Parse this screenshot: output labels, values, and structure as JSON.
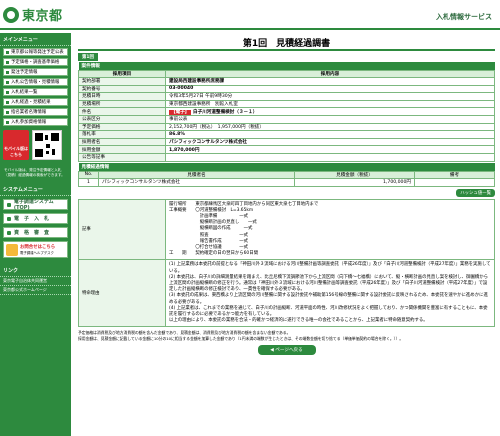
{
  "header": {
    "logo_text": "東京都",
    "service_name": "入札情報サービス"
  },
  "sidebar": {
    "menu_title": "メインメニュー",
    "items": [
      {
        "label": "東京都公報等発注予定公表"
      },
      {
        "label": "予定価格・調査基準価格"
      },
      {
        "label": "発注予定情報"
      },
      {
        "label": "入札公告情報・見積情報"
      },
      {
        "label": "入札結果一覧"
      },
      {
        "label": "入札経過・見積結果"
      },
      {
        "label": "指名業者名簿情報"
      },
      {
        "label": "入札参加資格情報"
      }
    ],
    "mobile_label": "モバイル版はこちら",
    "mobile_note": "モバイル版は、発注予定情報と入札（見積）経過情報の検索ができます。",
    "system_title": "システムメニュー",
    "system_items": [
      {
        "label": "電子調達システム(TOP)"
      },
      {
        "label": "電　子　入　札"
      },
      {
        "label": "資　格　審　査"
      }
    ],
    "contact_title": "お問合せはこちら",
    "contact_sub": "電子調達ヘルプデスク",
    "links_title": "リンク",
    "links": [
      {
        "label": "東京電子自治体共同運営"
      },
      {
        "label": "東京都公式ホームページ"
      }
    ]
  },
  "main": {
    "title": "第1回　見積経過調書",
    "tab_label": "第1回",
    "section_title": "案件情報",
    "col_item": "採用項目",
    "col_content": "採用内容",
    "rows": [
      {
        "label": "契約部署",
        "value": "建設局西建設事務所庶務課"
      },
      {
        "label": "契約番号",
        "value": "03-00040"
      },
      {
        "label": "見積日時",
        "value": "令和3年5月27日 午前9時30分"
      },
      {
        "label": "見積場所",
        "value": "東京都西建設事務所　別館入札室"
      },
      {
        "label": "件名",
        "tag": "【電子】",
        "value": "白子川河道整備検討（３－１）"
      },
      {
        "label": "公表区分",
        "value": "事前公表"
      },
      {
        "label": "予定価格",
        "value": "2,152,700円（税込）　1,957,000円（税抜）"
      },
      {
        "label": "落札率",
        "value": "86.8%"
      },
      {
        "label": "採用者名",
        "value": "パシフィックコンサルタンツ株式会社"
      },
      {
        "label": "採用金額",
        "value": "1,870,000円"
      },
      {
        "label": "公告等記事",
        "value": ""
      }
    ],
    "result_section_title": "見積経過情報",
    "result_cols": {
      "no": "No.",
      "name": "見積者名",
      "amount": "見積金額（税抜）",
      "note": "備考"
    },
    "results": [
      {
        "no": "1",
        "name": "パシフィックコンサルタンツ株式会社",
        "amount": "1,700,000円",
        "note": ""
      }
    ],
    "history_button": "ハッシュ値一覧",
    "notes": [
      {
        "label": "記事",
        "text": "履行場所　　東京都練馬区大泉町四丁目地内から同区東大泉七丁目地内まで\n工事概要　　〇河道整備検討　L=3.65km\n　　　　　　　計画準備　　　　　一式\n　　　　　　　縦横断計画の見直し　　一式\n　　　　　　　縦横断図の作成　　　一式\n　　　　　　　照査　　　　　　　一式\n　　　　　　　報告書作成　　　　一式\n　　　　　　〇打合せ協議　　　　一式\n工　　期　　契約確定の日の翌日から60日間"
      },
      {
        "label": "特命理由",
        "text": "(1) 上記業務は本委託の前提となる「神田川外３流域における河川整備計画等調査委託（平成26年度）」及び「白子川河道整備検討（平成27年度）」業務を実施している。\n(2) 本委託は、白子川の詳細測量結果を踏まえ、比丘尼橋下流調節池下から上流区間（向下橋～七福橋）において、縦・横断計画の見直し案を検討し、御園橋から上流区間の計画縦横断の修正を行う。通常は「神田川外３流域における河川整備計画等調査委託（平成26年度）」及び「白子川河道整備検討（平成27年度）」で設定した計画縦横断の修正検討であり、一貫性を確保する必要がある。\n(3) 本委託の成果は、東西橋より上流区間の河川整備に関する設計委託や補助第156号線の整備に関する設計委託に反映されるため、本委託を速やかに進めかに進める必要がある。\n(4) 上記業者は、これまでの業務を通じて、白子川の計画縦断、河道平面の時性、河川改修状況をよく把握しており、かつ関係機関を豊富に有することもに、本委託を履行するのに必要であるかつ能力を有している。\n以上の理由により、本委託の業務を合法・的確かつ経済的に遂行できる唯一の会社であることから、上記業者に特命随意契約する。"
      }
    ],
    "footnote": "予定価格は消費税及び地方消費税の額を含んだ金額であり、見積金額は、消費税及び地方消費税の額を含まない金額である。\n採用金額は、見積金額に記載している金額に10分の10に相当する金額を加算した金額であり（1円未満の端数が生じたときは、その端数金額を切り捨てる（単価単価契約の場合を除く。））。",
    "back_button": "ページへ戻る"
  }
}
